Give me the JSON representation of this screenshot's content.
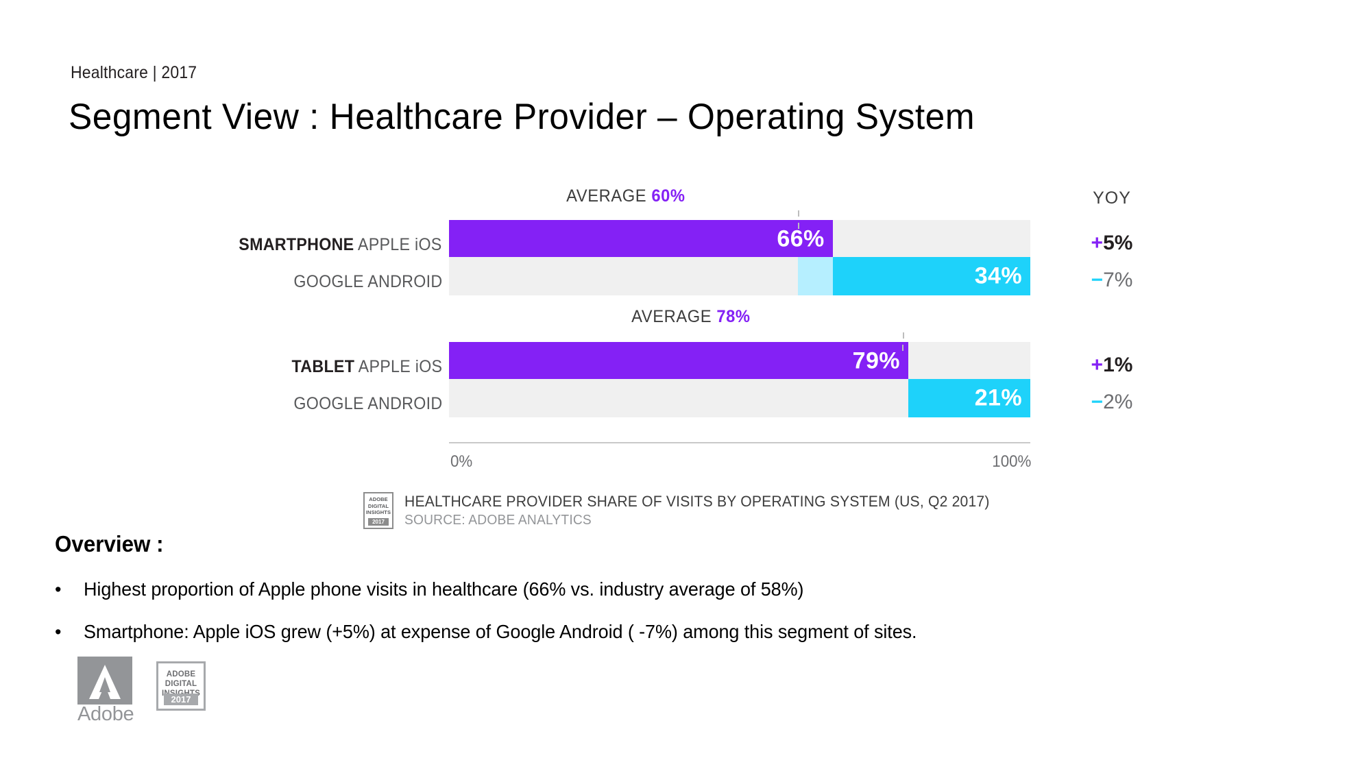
{
  "header": {
    "eyebrow": "Healthcare | 2017",
    "title": "Segment View : Healthcare Provider – Operating System"
  },
  "chart_data": {
    "type": "bar",
    "title": "HEALTHCARE PROVIDER SHARE OF VISITS BY OPERATING SYSTEM (US, Q2 2017)",
    "source": "SOURCE: ADOBE ANALYTICS",
    "orientation": "horizontal",
    "xlabel": "",
    "ylabel": "",
    "xlim": [
      0,
      100
    ],
    "axis_ticks": [
      "0%",
      "100%"
    ],
    "grid": false,
    "yoy_header": "YOY",
    "colors": {
      "ios": "#8421F5",
      "android": "#1ED2FA",
      "track": "#f0f0f0",
      "average_band": "#b6efff",
      "positive": "#8421F5",
      "negative": "#1ED2FA"
    },
    "groups": [
      {
        "name": "SMARTPHONE",
        "average_label": "AVERAGE",
        "average_value": "60%",
        "average_number": 60,
        "rows": [
          {
            "category_bold": "SMARTPHONE",
            "category_rest": "APPLE iOS",
            "value": 66,
            "value_label": "66%",
            "series": "ios",
            "yoy_sign": "+",
            "yoy_value": "5%",
            "yoy_direction": "up"
          },
          {
            "category_bold": "",
            "category_rest": "GOOGLE ANDROID",
            "value": 34,
            "value_label": "34%",
            "series": "android",
            "yoy_sign": "−",
            "yoy_value": "7%",
            "yoy_direction": "down"
          }
        ]
      },
      {
        "name": "TABLET",
        "average_label": "AVERAGE",
        "average_value": "78%",
        "average_number": 78,
        "rows": [
          {
            "category_bold": "TABLET",
            "category_rest": "APPLE iOS",
            "value": 79,
            "value_label": "79%",
            "series": "ios",
            "yoy_sign": "+",
            "yoy_value": "1%",
            "yoy_direction": "up"
          },
          {
            "category_bold": "",
            "category_rest": "GOOGLE ANDROID",
            "value": 21,
            "value_label": "21%",
            "series": "android",
            "yoy_sign": "−",
            "yoy_value": "2%",
            "yoy_direction": "down"
          }
        ]
      }
    ]
  },
  "footnote": {
    "badge": {
      "l1": "ADOBE",
      "l2": "DIGITAL",
      "l3": "INSIGHTS",
      "year": "2017"
    },
    "line1": "HEALTHCARE PROVIDER SHARE OF VISITS BY OPERATING SYSTEM (US, Q2 2017)",
    "line2": "SOURCE: ADOBE ANALYTICS"
  },
  "overview": {
    "heading": "Overview :",
    "bullet_glyph": "•",
    "items": [
      "Highest proportion of Apple phone visits in healthcare (66% vs. industry average of 58%)",
      "Smartphone: Apple iOS grew (+5%) at expense of Google Android ( -7%) among this segment of sites."
    ]
  },
  "logos": {
    "adobe_wordmark": "Adobe",
    "insights_badge": {
      "l1": "ADOBE",
      "l2": "DIGITAL",
      "l3": "INSIGHTS",
      "year": "2017"
    }
  }
}
